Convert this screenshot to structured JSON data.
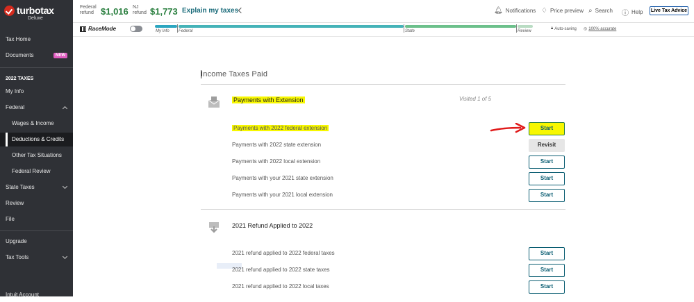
{
  "brand": {
    "name": "turbotax",
    "edition": "Deluxe"
  },
  "topbar": {
    "federal_label_1": "Federal",
    "federal_label_2": "refund",
    "federal_amount": "$1,016",
    "state_label_1": "NJ",
    "state_label_2": "refund",
    "state_amount": "$1,773",
    "explain_link": "Explain my taxes",
    "notifications": "Notifications",
    "price_preview": "Price preview",
    "search": "Search",
    "help": "Help",
    "live_advice": "Live Tax Advice"
  },
  "progress": {
    "racemode": "RaceMode",
    "steps": [
      "My Info",
      "Federal",
      "State",
      "Review"
    ],
    "autosaving": "Auto-saving",
    "accurate": "100% accurate",
    "colors": {
      "done": "#2ca6c0",
      "mid": "#6cc08b",
      "rest": "#b9dcc3"
    }
  },
  "sidebar": {
    "tax_home": "Tax Home",
    "documents": "Documents",
    "documents_badge": "NEW",
    "section_header": "2022 TAXES",
    "my_info": "My Info",
    "federal": "Federal",
    "wages": "Wages & Income",
    "deductions": "Deductions & Credits",
    "other": "Other Tax Situations",
    "federal_review": "Federal Review",
    "state_taxes": "State Taxes",
    "review": "Review",
    "file": "File",
    "upgrade": "Upgrade",
    "tax_tools": "Tax Tools",
    "intuit_account": "Intuit Account"
  },
  "main": {
    "title": "Income Taxes Paid",
    "section1": {
      "title": "Payments with Extension",
      "visited": "Visited 1 of 5",
      "rows": [
        {
          "label": "Payments with 2022 federal extension",
          "button": "Start"
        },
        {
          "label": "Payments with 2022 state extension",
          "button": "Revisit"
        },
        {
          "label": "Payments with 2022 local extension",
          "button": "Start"
        },
        {
          "label": "Payments with your 2021 state extension",
          "button": "Start"
        },
        {
          "label": "Payments with your 2021 local extension",
          "button": "Start"
        }
      ]
    },
    "section2": {
      "title": "2021 Refund Applied to 2022",
      "rows": [
        {
          "label": "2021 refund applied to 2022 federal taxes",
          "button": "Start"
        },
        {
          "label": "2021 refund applied to 2022 state taxes",
          "button": "Start"
        },
        {
          "label": "2021 refund applied to 2022 local taxes",
          "button": "Start"
        }
      ]
    },
    "annotation_color": "#e01a1a",
    "highlight_color": "#f7f700"
  }
}
